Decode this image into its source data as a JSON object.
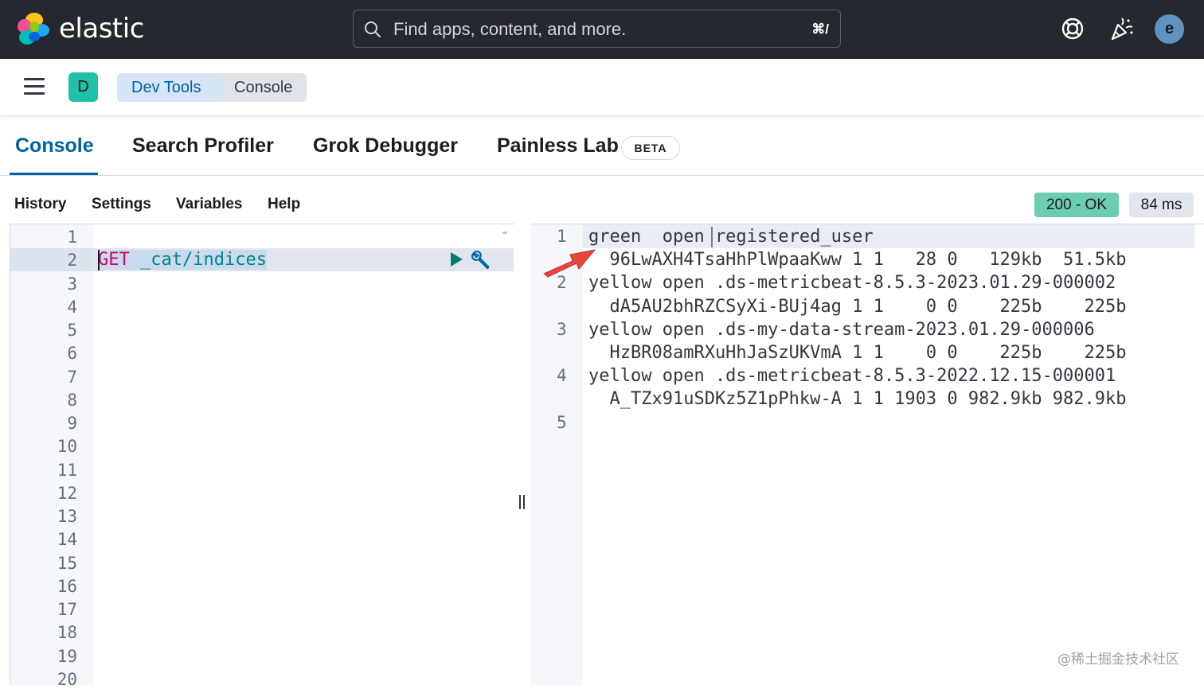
{
  "header": {
    "logo_text": "elastic",
    "search_placeholder": "Find apps, content, and more.",
    "search_shortcut": "⌘/",
    "avatar_initial": "e",
    "icons": [
      "help-icon",
      "news-feed-icon"
    ]
  },
  "breadcrumb": {
    "space_initial": "D",
    "items": [
      "Dev Tools",
      "Console"
    ]
  },
  "tabs": [
    {
      "label": "Console",
      "active": true
    },
    {
      "label": "Search Profiler",
      "active": false
    },
    {
      "label": "Grok Debugger",
      "active": false
    },
    {
      "label": "Painless Lab",
      "active": false
    }
  ],
  "beta_badge": "BETA",
  "console_menu": [
    "History",
    "Settings",
    "Variables",
    "Help"
  ],
  "response_status": {
    "code": "200 - OK",
    "time": "84 ms"
  },
  "request_editor": {
    "line_numbers": [
      "1",
      "2",
      "3",
      "4",
      "5",
      "6",
      "7",
      "8",
      "9",
      "10",
      "11",
      "12",
      "13",
      "14",
      "15",
      "16",
      "17",
      "18",
      "19",
      "20"
    ],
    "method": "GET",
    "path": " _cat/indices"
  },
  "response_editor": {
    "lines": [
      {
        "number": "1",
        "text": "green  open registered_user"
      },
      {
        "number": "",
        "text": "  96LwAXH4TsaHhPlWpaaKww 1 1   28 0   129kb  51.5kb"
      },
      {
        "number": "2",
        "text": "yellow open .ds-metricbeat-8.5.3-2023.01.29-000002"
      },
      {
        "number": "",
        "text": "  dA5AU2bhRZCSyXi-BUj4ag 1 1    0 0    225b    225b"
      },
      {
        "number": "3",
        "text": "yellow open .ds-my-data-stream-2023.01.29-000006"
      },
      {
        "number": "",
        "text": "  HzBR08amRXuHhJaSzUKVmA 1 1    0 0    225b    225b"
      },
      {
        "number": "4",
        "text": "yellow open .ds-metricbeat-8.5.3-2022.12.15-000001"
      },
      {
        "number": "",
        "text": "  A_TZx91uSDKz5Z1pPhkw-A 1 1 1903 0 982.9kb 982.9kb"
      },
      {
        "number": "5",
        "text": ""
      }
    ]
  },
  "watermark": "@稀土掘金技术社区",
  "colors": {
    "header_bg": "#25282f",
    "accent": "#0061a6",
    "status_ok": "#6dccb1",
    "annotation_arrow": "#e8463a"
  }
}
